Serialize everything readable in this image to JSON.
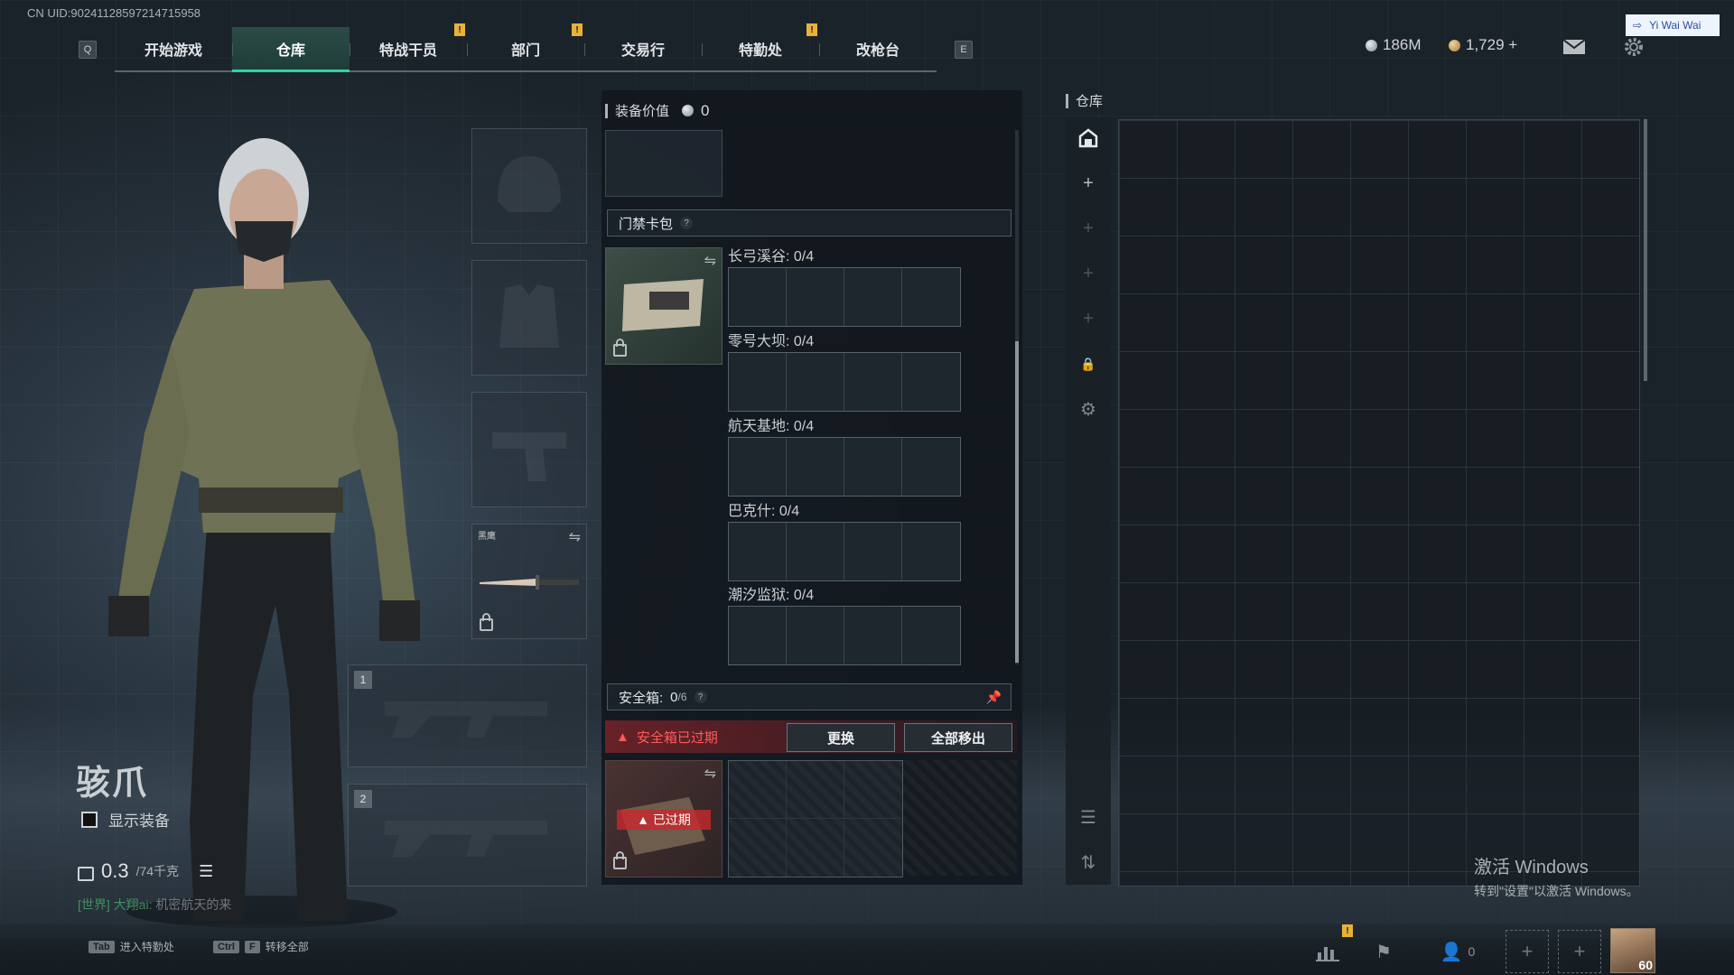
{
  "uid": "CN UID:90241128597214715958",
  "nav": {
    "left_key": "Q",
    "right_key": "E",
    "tabs": [
      "开始游戏",
      "仓库",
      "特战干员",
      "部门",
      "交易行",
      "特勤处",
      "改枪台"
    ],
    "active_tab": "仓库"
  },
  "currency": {
    "coins": "186M",
    "bonds": "1,729 +"
  },
  "user": {
    "name": "Yi Wai Wai"
  },
  "operator": {
    "name": "骇爪",
    "show_equipment_label": "显示装备",
    "weight": "0.3",
    "weight_cap": "/74千克"
  },
  "chat": {
    "channel": "[世界] 大翔ai:",
    "message": "机密航天的来"
  },
  "equipment_slots": {
    "melee_label": "黑鹰",
    "weapon_slot_1": "1",
    "weapon_slot_2": "2"
  },
  "loadout": {
    "value_label": "装备价值",
    "value": "0",
    "keycard_title": "门禁卡包",
    "help": "?",
    "maps": [
      {
        "name": "长弓溪谷: 0/4"
      },
      {
        "name": "零号大坝: 0/4"
      },
      {
        "name": "航天基地: 0/4"
      },
      {
        "name": "巴克什: 0/4"
      },
      {
        "name": "潮汐监狱: 0/4"
      }
    ],
    "safe_box_label": "安全箱:",
    "safe_box_count": "0",
    "safe_box_cap": "/6",
    "safe_box_expired": "安全箱已过期",
    "replace_btn": "更换",
    "move_all_btn": "全部移出",
    "expired_tag": "已过期"
  },
  "warehouse": {
    "title": "仓库"
  },
  "bottom": {
    "hint1_key": "Tab",
    "hint1_text": "进入特勤处",
    "hint2_key1": "Ctrl",
    "hint2_key2": "F",
    "hint2_text": "转移全部",
    "friends_count": "0",
    "level": "60"
  },
  "watermark": {
    "line1": "激活 Windows",
    "line2": "转到\"设置\"以激活 Windows。"
  },
  "colors": {
    "accent": "#2fd1a4",
    "warning": "#e8b13a",
    "danger": "#e04848"
  }
}
